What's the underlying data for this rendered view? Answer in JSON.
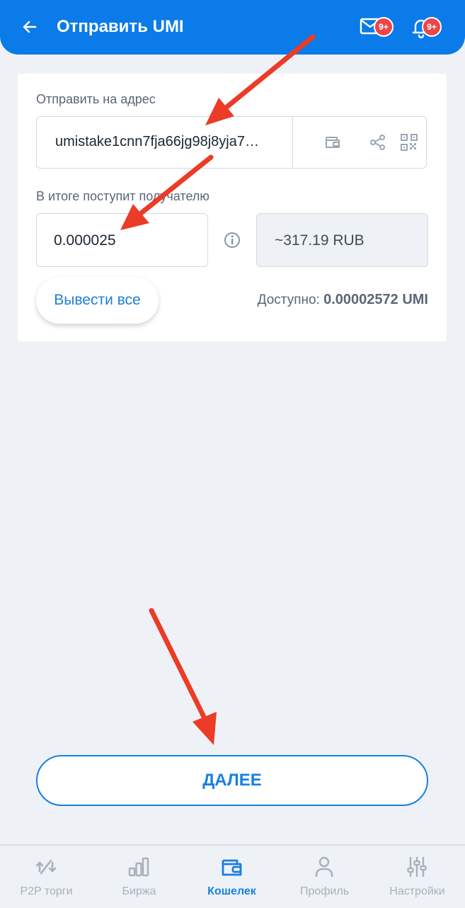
{
  "header": {
    "title": "Отправить UMI",
    "mail_badge": "9+",
    "bell_badge": "9+",
    "color": "#0a7be8"
  },
  "form": {
    "address_label": "Отправить на адрес",
    "address_value": "umistake1cnn7fja66jg98j8yja7…",
    "amount_label": "В итоге поступит получателю",
    "amount_value": "0.000025",
    "fiat_value": "~317.19 RUB",
    "withdraw_all_label": "Вывести все",
    "available_label": "Доступно:",
    "available_value": "0.00002572 UMI"
  },
  "next_button": {
    "label": "ДАЛЕЕ"
  },
  "bottom_nav": {
    "items": [
      {
        "label": "P2P торги",
        "icon": "p2p-icon"
      },
      {
        "label": "Биржа",
        "icon": "chart-bars-icon"
      },
      {
        "label": "Кошелек",
        "icon": "wallet-icon",
        "active": true
      },
      {
        "label": "Профиль",
        "icon": "person-icon"
      },
      {
        "label": "Настройки",
        "icon": "sliders-icon"
      }
    ]
  },
  "annotations": {
    "arrow_color": "#ec3b26"
  }
}
